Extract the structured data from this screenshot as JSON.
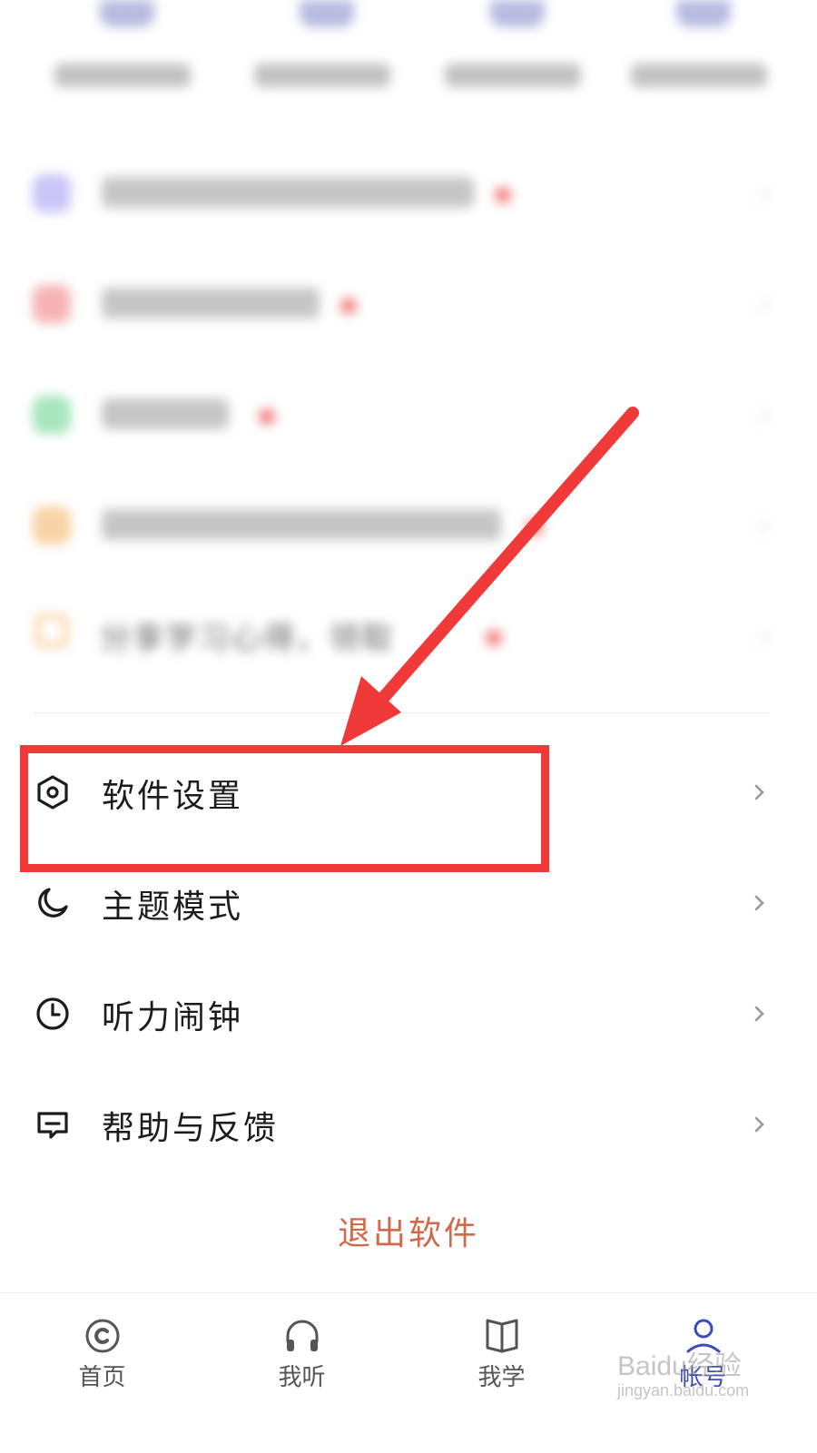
{
  "blurred_section": {
    "share_row_text": "分享学习心得，领取"
  },
  "menu": {
    "items": [
      {
        "label": "软件设置",
        "icon": "hexagon-settings-icon"
      },
      {
        "label": "主题模式",
        "icon": "moon-icon"
      },
      {
        "label": "听力闹钟",
        "icon": "clock-icon"
      },
      {
        "label": "帮助与反馈",
        "icon": "feedback-message-icon"
      }
    ],
    "logout_label": "退出软件"
  },
  "tabbar": {
    "tabs": [
      {
        "label": "首页",
        "icon": "home-circle-icon",
        "active": false
      },
      {
        "label": "我听",
        "icon": "headphones-icon",
        "active": false
      },
      {
        "label": "我学",
        "icon": "open-book-icon",
        "active": false
      },
      {
        "label": "帐号",
        "icon": "user-icon",
        "active": true
      }
    ]
  },
  "colors": {
    "annotation_red": "#f03a3a",
    "logout_text": "#d2694a",
    "active_tab": "#3b4cb8"
  },
  "watermark": {
    "brand": "Baidu经验",
    "url": "jingyan.baidu.com"
  }
}
